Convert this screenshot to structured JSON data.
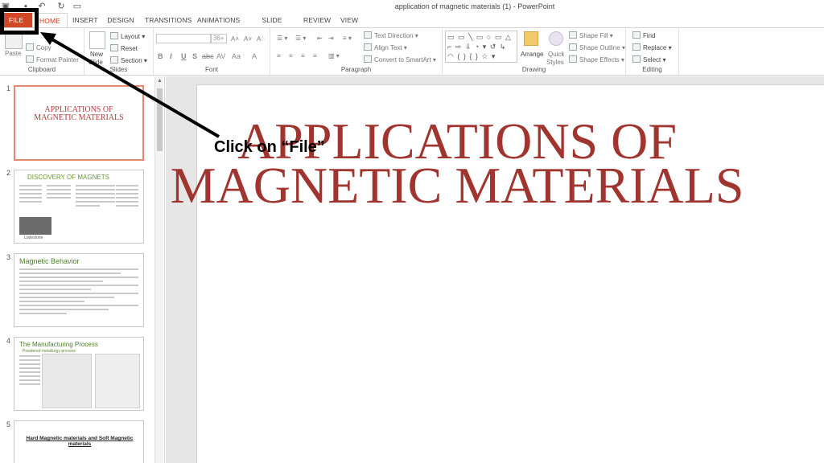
{
  "window": {
    "title": "application of magnetic materials (1) - PowerPoint"
  },
  "quick_access": [
    "save-icon",
    "undo-icon",
    "redo-icon",
    "present-icon"
  ],
  "tabs": [
    {
      "label": "FILE"
    },
    {
      "label": "HOME"
    },
    {
      "label": "INSERT"
    },
    {
      "label": "DESIGN"
    },
    {
      "label": "TRANSITIONS"
    },
    {
      "label": "ANIMATIONS"
    },
    {
      "label": "SLIDE SHOW"
    },
    {
      "label": "REVIEW"
    },
    {
      "label": "VIEW"
    }
  ],
  "ribbon": {
    "clipboard": {
      "label": "Clipboard",
      "paste": "Paste",
      "copy": "Copy",
      "format_painter": "Format Painter"
    },
    "slides": {
      "label": "Slides",
      "new_slide_1": "New",
      "new_slide_2": "Slide",
      "layout": "Layout",
      "reset": "Reset",
      "section": "Section"
    },
    "font": {
      "label": "Font",
      "size": "36+",
      "buttons": [
        "B",
        "I",
        "U",
        "S",
        "abc",
        "AV",
        "Aa",
        "A"
      ]
    },
    "paragraph": {
      "label": "Paragraph",
      "text_direction": "Text Direction",
      "align_text": "Align Text",
      "convert_smartart": "Convert to SmartArt"
    },
    "drawing": {
      "label": "Drawing",
      "arrange": "Arrange",
      "quick_styles_1": "Quick",
      "quick_styles_2": "Styles",
      "shape_fill": "Shape Fill",
      "shape_outline": "Shape Outline",
      "shape_effects": "Shape Effects",
      "shapes": "▭ ▭ ╲ ▭ ○ ▭ △ ⌐ ⇨ ⇩ ◔ ▾ ↺ ↳ ◠ ( ) { } ☆ ▾"
    },
    "editing": {
      "label": "Editing",
      "find": "Find",
      "replace": "Replace",
      "select": "Select"
    }
  },
  "slides": [
    {
      "number": "1",
      "title": "APPLICATIONS OF\nMAGNETIC MATERIALS"
    },
    {
      "number": "2",
      "title": "DISCOVERY OF MAGNETS",
      "caption": "Lodestone"
    },
    {
      "number": "3",
      "title": "Magnetic Behavior"
    },
    {
      "number": "4",
      "title": "The Manufacturing Process",
      "subtitle": "Powdered metallurgy process"
    },
    {
      "number": "5",
      "title": "Hard Magnetic materials and Soft Magnetic materials"
    }
  ],
  "main_slide": {
    "title": "APPLICATIONS OF\nMAGNETIC MATERIALS"
  },
  "callout": {
    "text": "Click on “File”"
  },
  "colors": {
    "file_tab": "#d24726",
    "title_red": "#a0352f",
    "highlight": "#000000"
  }
}
